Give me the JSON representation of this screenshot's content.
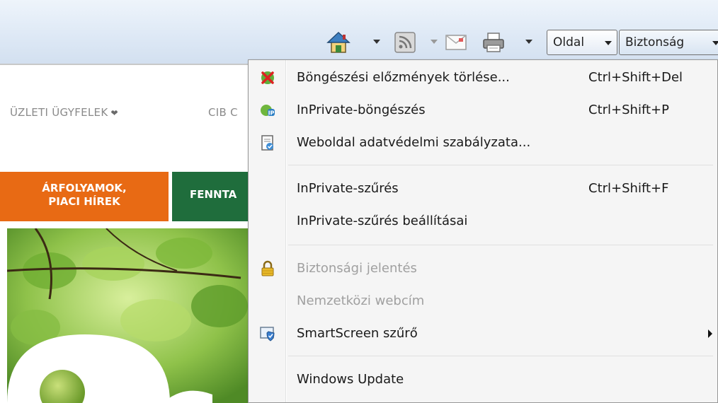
{
  "toolbar": {
    "page_label": "Oldal",
    "safety_label": "Biztonság"
  },
  "page": {
    "nav": [
      "ÜZLETI ÜGYFELEK",
      "CIB C"
    ],
    "tile_orange": [
      "ÁRFOLYAMOK,",
      "PIACI HÍREK"
    ],
    "tile_green": "FENNTA"
  },
  "menu": {
    "items": [
      {
        "label": "Böngészési előzmények törlése...",
        "shortcut": "Ctrl+Shift+Del",
        "icon": "delete-history-icon"
      },
      {
        "label": "InPrivate-böngészés",
        "shortcut": "Ctrl+Shift+P",
        "icon": "inprivate-icon"
      },
      {
        "label": "Weboldal adatvédelmi szabályzata...",
        "shortcut": "",
        "icon": "privacy-policy-icon"
      },
      {
        "label": "InPrivate-szűrés",
        "shortcut": "Ctrl+Shift+F",
        "icon": ""
      },
      {
        "label": "InPrivate-szűrés beállításai",
        "shortcut": "",
        "icon": ""
      },
      {
        "label": "Biztonsági jelentés",
        "shortcut": "",
        "icon": "lock-icon",
        "disabled": true
      },
      {
        "label": "Nemzetközi webcím",
        "shortcut": "",
        "icon": "",
        "disabled": true
      },
      {
        "label": "SmartScreen szűrő",
        "shortcut": "",
        "icon": "smartscreen-icon",
        "submenu": true
      },
      {
        "label": "Windows Update",
        "shortcut": "",
        "icon": ""
      }
    ]
  }
}
